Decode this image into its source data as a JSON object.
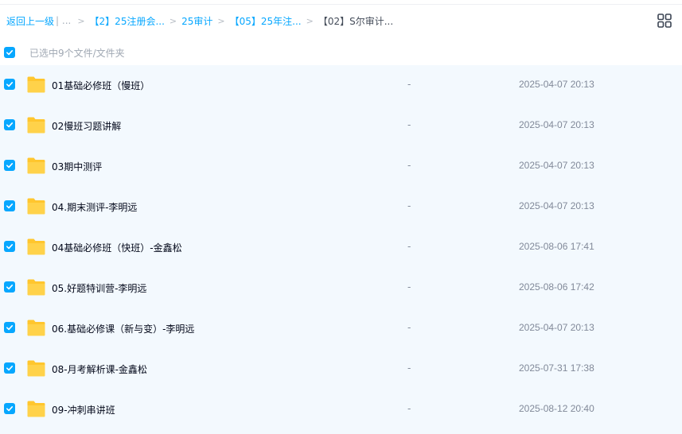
{
  "breadcrumb": {
    "back": "返回上一级",
    "divider": "| ...",
    "items": [
      "【2】25注册会...",
      "25审计",
      "【05】25年注..."
    ],
    "current": "【02】S尔审计...",
    "separator": ">"
  },
  "selection": {
    "text": "已选中9个文件/文件夹"
  },
  "files": [
    {
      "name": "01基础必修班（慢班）",
      "size": "-",
      "date": "2025-04-07 20:13"
    },
    {
      "name": "02慢班习题讲解",
      "size": "-",
      "date": "2025-04-07 20:13"
    },
    {
      "name": "03期中测评",
      "size": "-",
      "date": "2025-04-07 20:13"
    },
    {
      "name": "04.期末测评-李明远",
      "size": "-",
      "date": "2025-04-07 20:13"
    },
    {
      "name": "04基础必修班（快班）-金鑫松",
      "size": "-",
      "date": "2025-08-06 17:41"
    },
    {
      "name": "05.好题特训营-李明远",
      "size": "-",
      "date": "2025-08-06 17:42"
    },
    {
      "name": "06.基础必修课（新与变）-李明远",
      "size": "-",
      "date": "2025-04-07 20:13"
    },
    {
      "name": "08-月考解析课-金鑫松",
      "size": "-",
      "date": "2025-07-31 17:38"
    },
    {
      "name": "09-冲刺串讲班",
      "size": "-",
      "date": "2025-08-12 20:40"
    }
  ],
  "icons": {
    "checkbox": "checkbox-checked-icon",
    "folder": "folder-icon",
    "view_toggle": "grid-view-icon"
  },
  "colors": {
    "accent": "#06a7ff",
    "row_selected_bg": "#f3f9fe",
    "folder": "#ffc62e"
  }
}
